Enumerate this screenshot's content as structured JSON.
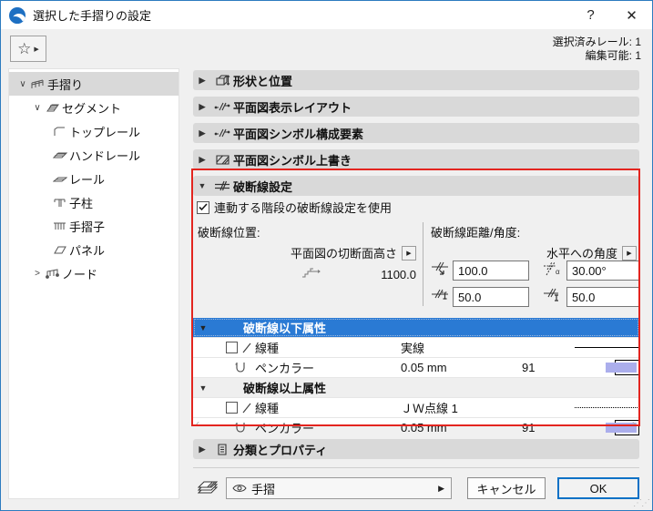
{
  "window": {
    "title": "選択した手摺りの設定",
    "help_label": "?",
    "close_label": "✕",
    "selected_rails_info": "選択済みレール: 1",
    "editable_info": "編集可能: 1"
  },
  "tree": {
    "items": [
      {
        "label": "手摺り",
        "icon": "railing-icon",
        "state": "expanded",
        "selected": true
      },
      {
        "label": "セグメント",
        "icon": "segment-icon",
        "state": "expanded",
        "selected": false
      },
      {
        "label": "トップレール",
        "icon": "toprail-icon",
        "state": "leaf",
        "selected": false
      },
      {
        "label": "ハンドレール",
        "icon": "handrail-icon",
        "state": "leaf",
        "selected": false
      },
      {
        "label": "レール",
        "icon": "rail-icon",
        "state": "leaf",
        "selected": false
      },
      {
        "label": "子柱",
        "icon": "post-icon",
        "state": "leaf",
        "selected": false
      },
      {
        "label": "手摺子",
        "icon": "baluster-icon",
        "state": "leaf",
        "selected": false
      },
      {
        "label": "パネル",
        "icon": "panel-icon",
        "state": "leaf",
        "selected": false
      },
      {
        "label": "ノード",
        "icon": "node-icon",
        "state": "collapsed",
        "selected": false
      }
    ]
  },
  "sections": {
    "shape_position": "形状と位置",
    "floorplan_layout": "平面図表示レイアウト",
    "floorplan_components": "平面図シンボル構成要素",
    "floorplan_override": "平面図シンボル上書き",
    "breakline": "破断線設定",
    "classification": "分類とプロパティ"
  },
  "breakline_panel": {
    "use_stair_settings_label": "連動する階段の破断線設定を使用",
    "use_stair_settings_checked": true,
    "position_label": "破断線位置:",
    "cut_plane_button_label": "平面図の切断面高さ",
    "cut_plane_value": "1100.0",
    "distance_angle_label": "破断線距離/角度:",
    "angle_button_label": "水平への角度",
    "fields": [
      {
        "name": "distance-1",
        "value": "100.0"
      },
      {
        "name": "angle",
        "value": "30.00°"
      },
      {
        "name": "distance-2",
        "value": "50.0"
      },
      {
        "name": "distance-3",
        "value": "50.0"
      }
    ],
    "attributes": {
      "below_group_title": "破断線以下属性",
      "above_group_title": "破断線以上属性",
      "linetype_label": "線種",
      "pencolor_label": "ペンカラー",
      "below_linetype_value": "実線",
      "below_pen_weight": "0.05 mm",
      "below_pen_number": "91",
      "above_linetype_value": "ＪＷ点線 1",
      "above_pen_weight": "0.05 mm",
      "above_pen_number": "91"
    }
  },
  "footer": {
    "layer_value": "手摺",
    "cancel_label": "キャンセル",
    "ok_label": "OK"
  },
  "colors": {
    "selected_row_blue": "#2a7ad4",
    "pen_swatch": "#abaeec",
    "annotation_red": "#e3251f",
    "window_border_blue": "#2c7bbf",
    "section_bar_gray": "#d9d9d9"
  }
}
